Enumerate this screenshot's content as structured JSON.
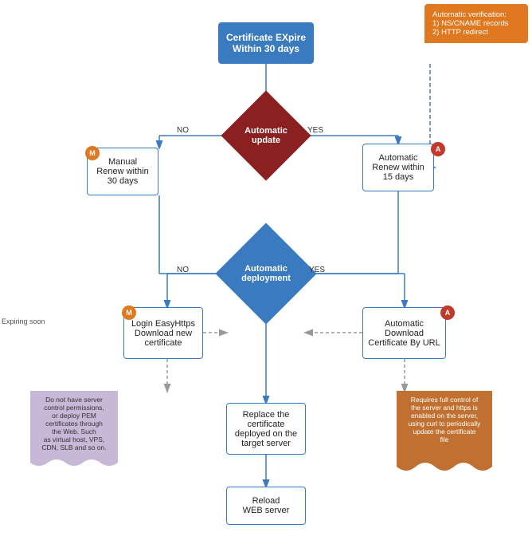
{
  "nodes": {
    "cert_expire": "Certificate EXpire\nWithin 30 days",
    "auto_update_label": "Automatic\nupdate",
    "manual_renew": "Manual\nRenew within\n30 days",
    "auto_renew": "Automatic\nRenew within\n15 days",
    "auto_deploy_label": "Automatic\ndeployment",
    "login_easyhttps": "Login EasyHttps\nDownload new\ncertificate",
    "auto_dl_cert": "Automatic\nDownload\nCertificate By URL",
    "replace_cert": "Replace the\ncertificate\ndeployed on the\ntarget server",
    "reload_web": "Reload\nWEB server",
    "no_perm": "Do not have server\ncontrol permissions,\nor deploy PEM\ncertificates through\nthe Web. Such\nas virtual host, VPS,\nCDN, SLB and so on.",
    "full_ctrl": "Requires full control of\nthe server and https is\nenabled on the server,\nusing curl to periodically\nupdate the certificate\nfile"
  },
  "labels": {
    "no": "NO",
    "yes": "YES",
    "auto_verify_title": "Automatic verification:",
    "auto_verify_1": "1) NS/CNAME records",
    "auto_verify_2": "2) HTTP redirect",
    "expiring_soon": "Expiring soon",
    "badge_m": "M",
    "badge_a": "A"
  },
  "colors": {
    "blue": "#3a7abf",
    "dark_red": "#8b2020",
    "orange": "#e07820",
    "purple_bg": "#c8b8d8",
    "orange_bg": "#c07030",
    "white": "#ffffff"
  }
}
